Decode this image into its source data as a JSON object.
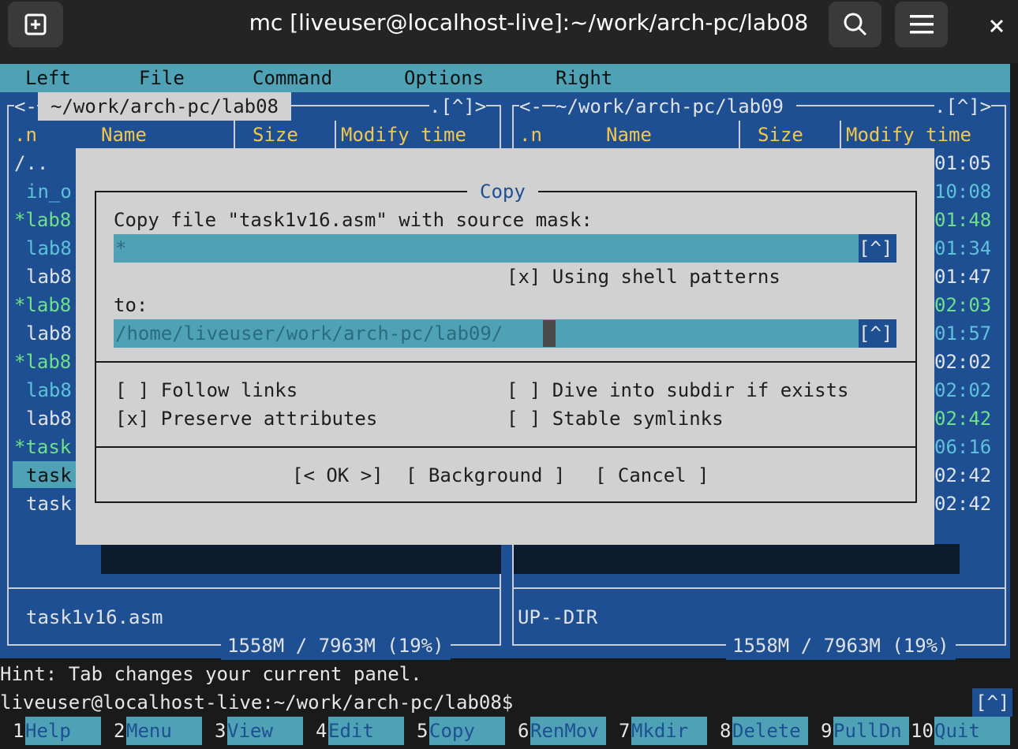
{
  "window": {
    "title": "mc [liveuser@localhost-live]:~/work/arch-pc/lab08"
  },
  "menubar": [
    "Left",
    "File",
    "Command",
    "Options",
    "Right"
  ],
  "left_panel": {
    "path": "~/work/arch-pc/lab08",
    "corner": ".[^]>",
    "corner_left": "<-",
    "columns": [
      ".n",
      "Name",
      "Size",
      "Modify time"
    ],
    "rows": [
      "/..",
      "in_o",
      "*lab8",
      "lab8",
      "lab8",
      "*lab8",
      "lab8",
      "*lab8",
      "lab8",
      "lab8",
      "*task",
      "task",
      "task"
    ],
    "status": "task1v16.asm",
    "disk": "1558M / 7963M (19%)"
  },
  "right_panel": {
    "path": "~/work/arch-pc/lab09",
    "corner": ".[^]>",
    "corner_left": "<-",
    "columns": [
      ".n",
      "Name",
      "Size",
      "Modify time"
    ],
    "times": [
      "01:05",
      "10:08",
      "01:48",
      "01:34",
      "01:47",
      "02:03",
      "01:57",
      "02:02",
      "02:02",
      "02:42",
      "06:16",
      "02:42",
      "02:42"
    ],
    "status": "UP--DIR",
    "disk": "1558M / 7963M (19%)"
  },
  "dialog": {
    "title": "Copy",
    "prompt": "Copy file \"task1v16.asm\" with source mask:",
    "mask_value": "*",
    "history_btn": "[^]",
    "shell_patterns": "[x] Using shell patterns",
    "to_label": "to:",
    "dest_value": "/home/liveuser/work/arch-pc/lab09/",
    "follow_links": "[ ] Follow links",
    "preserve_attrs": "[x] Preserve attributes",
    "dive_into": "[ ] Dive into subdir if exists",
    "stable_symlinks": "[ ] Stable symlinks",
    "ok_button": "[< OK >]",
    "background_button": "[ Background ]",
    "cancel_button": "[ Cancel ]"
  },
  "hint": "Hint: Tab changes your current panel.",
  "prompt_line": "liveuser@localhost-live:~/work/arch-pc/lab08$",
  "prompt_history": "[^]",
  "fkeys": [
    {
      "num": "1",
      "label": "Help"
    },
    {
      "num": "2",
      "label": "Menu"
    },
    {
      "num": "3",
      "label": "View"
    },
    {
      "num": "4",
      "label": "Edit"
    },
    {
      "num": "5",
      "label": "Copy"
    },
    {
      "num": "6",
      "label": "RenMov"
    },
    {
      "num": "7",
      "label": "Mkdir"
    },
    {
      "num": "8",
      "label": "Delete"
    },
    {
      "num": "9",
      "label": "PullDn"
    },
    {
      "num": "10",
      "label": "Quit"
    }
  ],
  "colors": {
    "panel_bg": "#1f4f93",
    "menubar_bg": "#4fa2b5",
    "dialog_bg": "#d1d1d1",
    "header_fg": "#f2c84b",
    "exec_fg": "#6fe08a"
  }
}
